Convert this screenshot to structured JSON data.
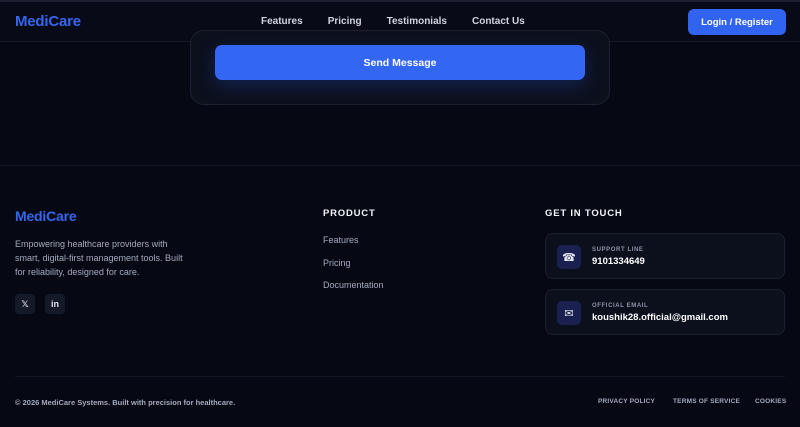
{
  "navbar": {
    "logo": "MediCare",
    "links": [
      "Features",
      "Pricing",
      "Testimonials",
      "Contact Us"
    ],
    "login_label": "Login / Register"
  },
  "contact_form": {
    "submit_label": "Send Message"
  },
  "footer": {
    "logo": "MediCare",
    "tagline": "Empowering healthcare providers with smart, digital-first management tools. Built for reliability, designed for care.",
    "social": {
      "x_glyph": "𝕏",
      "linkedin_glyph": "in"
    },
    "product": {
      "heading": "PRODUCT",
      "links": [
        "Features",
        "Pricing",
        "Documentation"
      ]
    },
    "contact": {
      "heading": "GET IN TOUCH",
      "support": {
        "icon": "☎",
        "label": "SUPPORT LINE",
        "value": "9101334649"
      },
      "email": {
        "icon": "✉",
        "label": "OFFICIAL EMAIL",
        "value": "koushik28.official@gmail.com"
      }
    },
    "copyright": "© 2026 MediCare Systems. Built with precision for healthcare.",
    "legal_links": [
      "PRIVACY POLICY",
      "TERMS OF SERVICE",
      "COOKIES"
    ]
  },
  "colors": {
    "brand": "#3566f0",
    "background": "#060914",
    "card": "#0c101d"
  }
}
